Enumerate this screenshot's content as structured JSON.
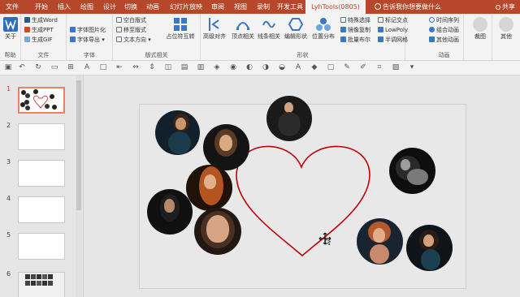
{
  "tabs": [
    "文件",
    "开始",
    "插入",
    "绘图",
    "设计",
    "切换",
    "动画",
    "幻灯片放映",
    "审阅",
    "视图",
    "录制",
    "开发工具",
    "LyhTools(0805)"
  ],
  "search_placeholder": "告诉我你想要做什么",
  "share_label": "共享",
  "ribbon": {
    "help": {
      "about": "关于",
      "group": "帮助"
    },
    "file": {
      "word": "生成Word",
      "ppt": "生成PPT",
      "gif": "生成GIF",
      "group": "文件"
    },
    "font": {
      "to_image": "字体图片化",
      "export": "字体导出",
      "group": "字体"
    },
    "layout": {
      "blank": "空白版式",
      "move": "移至版式",
      "text_dir": "文本方向",
      "swap": "占位符互转",
      "group": "版式相关"
    },
    "shape": {
      "align": "高级对齐",
      "vertex": "顶点相关",
      "line": "线条相关",
      "edit": "编辑形状",
      "pos": "位置分布",
      "special": "特殊选择",
      "mirror": "镜像复制",
      "bool": "批量布尔",
      "mark": "标记交点",
      "lowpoly": "LowPoly",
      "grid": "半调网格",
      "group": "形状"
    },
    "anim": {
      "timeline": "时间序列",
      "combine": "组合动画",
      "other": "其他动画",
      "group": "动画"
    },
    "crop": "裁图",
    "misc": "其他"
  },
  "slides": [
    "1",
    "2",
    "3",
    "4",
    "5",
    "6"
  ],
  "colors": {
    "accent": "#b7472a",
    "heart": "#c00000",
    "selected_border": "#e8845e"
  }
}
